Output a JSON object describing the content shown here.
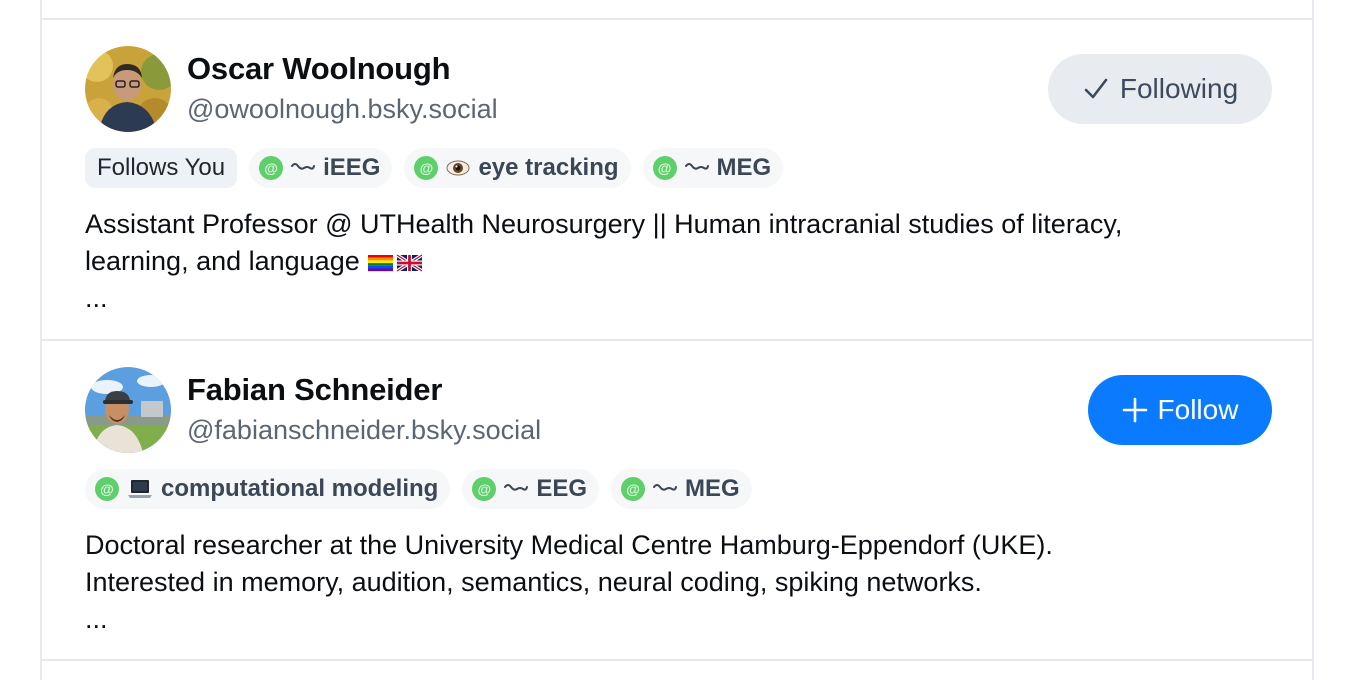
{
  "accounts": [
    {
      "name": "Oscar Woolnough",
      "handle": "@owoolnough.bsky.social",
      "button_label": "Following",
      "button_state": "following",
      "badge": "Follows You",
      "labels": [
        {
          "icon": "wave-icon",
          "text": "iEEG"
        },
        {
          "icon": "eye-icon",
          "text": "eye tracking"
        },
        {
          "icon": "wave-icon",
          "text": "MEG"
        }
      ],
      "description": "Assistant Professor @ UTHealth Neurosurgery || Human intracranial studies of literacy,\nlearning, and language",
      "description_emoji": [
        "rainbow-flag-icon",
        "uk-flag-icon"
      ],
      "ellipsis": "..."
    },
    {
      "name": "Fabian Schneider",
      "handle": "@fabianschneider.bsky.social",
      "button_label": "Follow",
      "button_state": "not-following",
      "labels": [
        {
          "icon": "laptop-icon",
          "text": "computational modeling"
        },
        {
          "icon": "wave-icon",
          "text": "EEG"
        },
        {
          "icon": "wave-icon",
          "text": "MEG"
        }
      ],
      "description": "Doctoral researcher at the University Medical Centre Hamburg-Eppendorf (UKE).\nInterested in memory, audition, semantics, neural coding, spiking networks.",
      "ellipsis": "..."
    }
  ],
  "label_marker": "@",
  "colors": {
    "follow_blue": "#0a7aff",
    "following_bg": "#e8ecf1",
    "label_dot": "#5ecf6a",
    "divider": "#e6e9ee"
  }
}
